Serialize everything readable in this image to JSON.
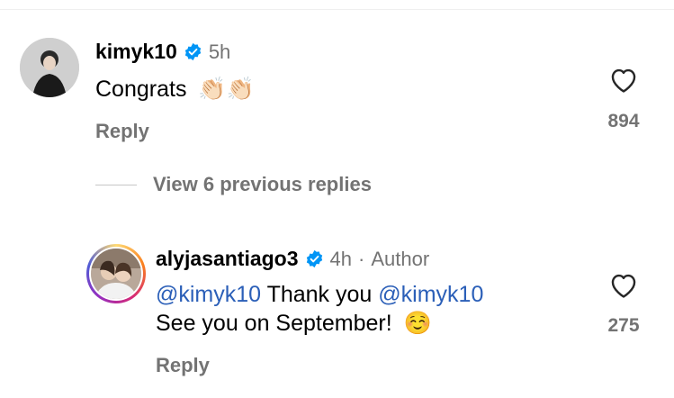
{
  "comments": [
    {
      "username": "kimyk10",
      "time": "5h",
      "text": "Congrats",
      "emoji": "👏🏻👏🏻",
      "reply_label": "Reply",
      "likes": "894",
      "avatar_icon": "profile-photo"
    }
  ],
  "view_replies": {
    "label": "View 6 previous replies"
  },
  "replies": [
    {
      "username": "alyjasantiago3",
      "time": "4h",
      "separator": "·",
      "badge": "Author",
      "mention_1": "@kimyk10",
      "text_1": "Thank you",
      "mention_2": "@kimyk10",
      "line_2": "See you on September!",
      "emoji": "☺️",
      "reply_label": "Reply",
      "likes": "275",
      "avatar_icon": "profile-photo"
    }
  ],
  "colors": {
    "secondary_text": "#737373",
    "verified_blue": "#0095f6",
    "mention": "#2b5fb8"
  }
}
